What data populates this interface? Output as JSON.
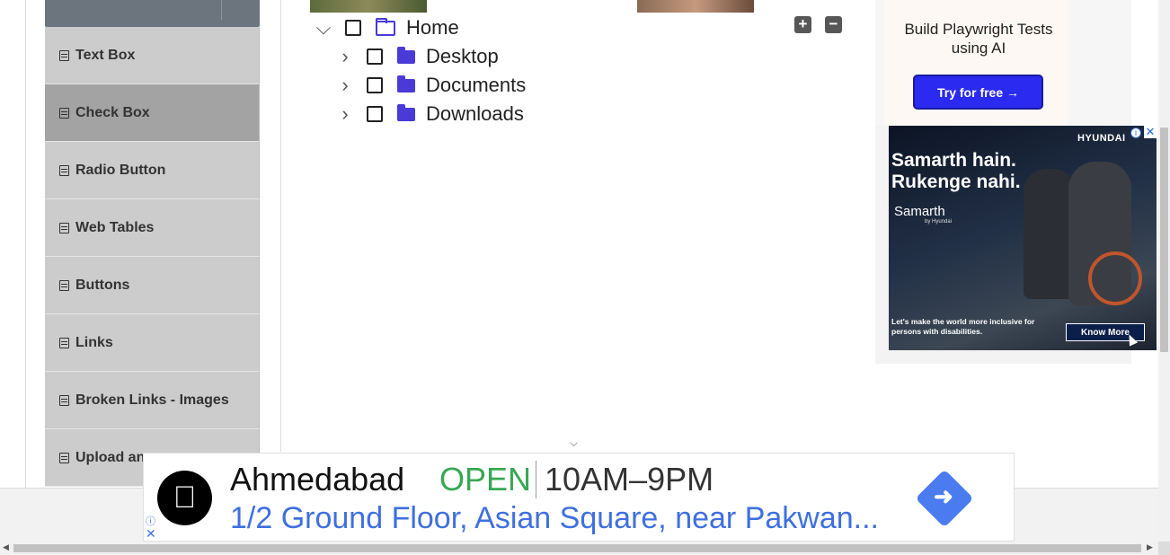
{
  "sidebar": {
    "items": [
      {
        "label": "Text Box",
        "icon": "form-icon"
      },
      {
        "label": "Check Box",
        "icon": "form-icon",
        "active": true
      },
      {
        "label": "Radio Button",
        "icon": "form-icon"
      },
      {
        "label": "Web Tables",
        "icon": "form-icon"
      },
      {
        "label": "Buttons",
        "icon": "form-icon"
      },
      {
        "label": "Links",
        "icon": "form-icon"
      },
      {
        "label": "Broken Links - Images",
        "icon": "form-icon"
      },
      {
        "label": "Upload an",
        "icon": "form-icon"
      }
    ]
  },
  "tree": {
    "expand_all_glyph": "+",
    "collapse_all_glyph": "−",
    "root": {
      "label": "Home",
      "expanded": true,
      "checked": false
    },
    "children": [
      {
        "label": "Desktop",
        "expanded": false,
        "checked": false
      },
      {
        "label": "Documents",
        "expanded": false,
        "checked": false
      },
      {
        "label": "Downloads",
        "expanded": false,
        "checked": false
      }
    ]
  },
  "ads": {
    "top": {
      "title": "Build Playwright Tests using AI",
      "button": "Try for free →"
    },
    "hyundai": {
      "brand": "HYUNDAI",
      "headline": "Samarth hain. Rukenge nahi.",
      "logo_text": "Samarth",
      "logo_sub": "by Hyundai",
      "footnote": "Let's make the world more inclusive for persons with disabilities.",
      "cta": "Know More"
    },
    "banner": {
      "city": "Ahmedabad",
      "status": "OPEN",
      "hours": "10AM–9PM",
      "address": "1/2 Ground Floor, Asian Square, near Pakwan...",
      "accent_status": "#36a852",
      "accent_link": "#3f6fe0"
    }
  },
  "colors": {
    "active_item": "#a3a3a3",
    "item": "#cccccc",
    "folder": "#4a3ad8"
  }
}
